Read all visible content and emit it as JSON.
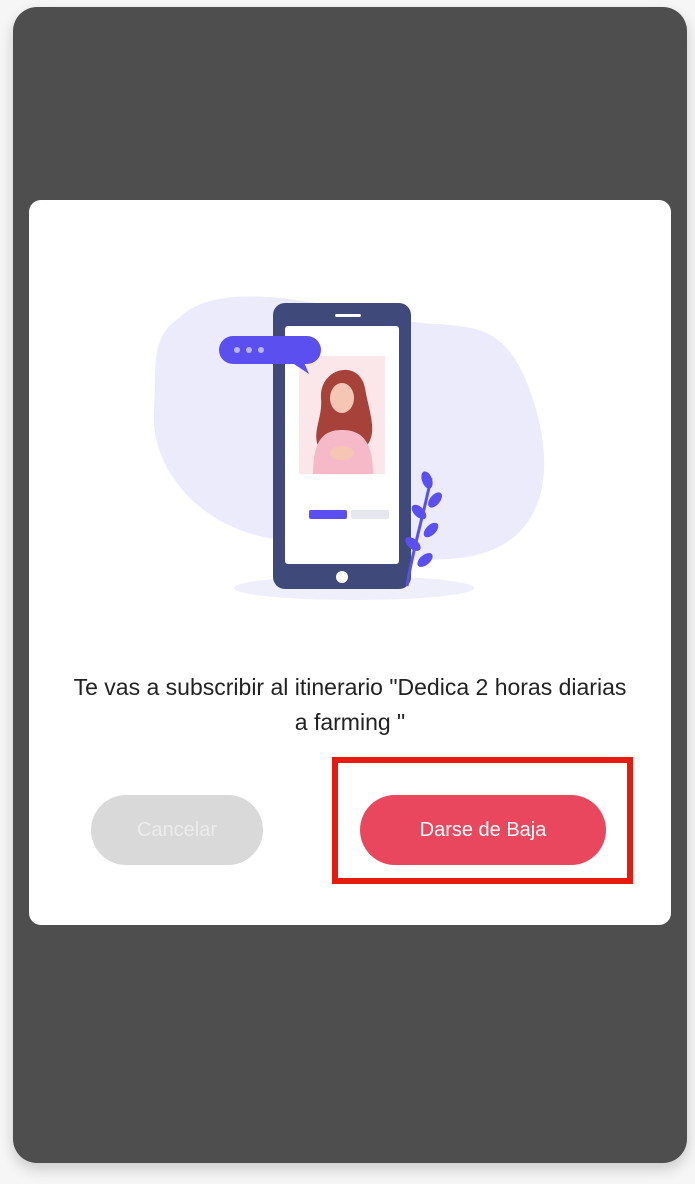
{
  "dialog": {
    "message": "Te vas a subscribir al itinerario \"Dedica 2 horas diarias a farming \"",
    "cancel_label": "Cancelar",
    "unsubscribe_label": "Darse de Baja"
  },
  "colors": {
    "overlay": "#4e4e4e",
    "primary_button": "#e8475d",
    "secondary_button": "#d9d9d9",
    "illustration_accent": "#5b4ff0",
    "illustration_phone": "#3f4a7a",
    "highlight": "#e61a0e"
  }
}
